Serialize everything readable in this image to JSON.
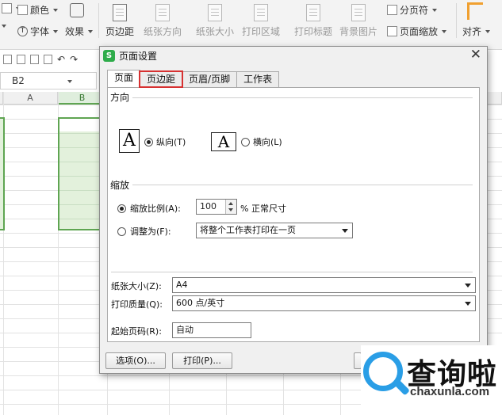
{
  "ribbon": {
    "row1_items": [
      "颜色"
    ],
    "row2_items": [
      "字体",
      "效果"
    ],
    "buttons": [
      "页边距",
      "纸张方向",
      "纸张大小",
      "打印区域",
      "打印标题",
      "背景图片"
    ],
    "right_top": "分页符",
    "right_bottom": "页面缩放",
    "far_right": "对齐"
  },
  "namebox": {
    "value": "B2"
  },
  "sheet": {
    "columns": [
      "A",
      "B"
    ]
  },
  "dialog": {
    "title": "页面设置",
    "tabs": [
      "页面",
      "页边距",
      "页眉/页脚",
      "工作表"
    ],
    "selected_tab": "页面",
    "highlighted_tab": "页边距",
    "highlight_color": "#d73131",
    "orientation": {
      "label": "方向",
      "portrait_label": "纵向(T)",
      "landscape_label": "横向(L)",
      "portrait_icon_text": "A",
      "landscape_icon_text": "A",
      "selected": "portrait"
    },
    "scaling": {
      "label": "缩放",
      "scale_option": "缩放比例(A):",
      "scale_value": "100",
      "scale_unit": "% 正常尺寸",
      "fit_option": "调整为(F):",
      "fit_value": "将整个工作表打印在一页",
      "selected": "scale"
    },
    "paper_size": {
      "label": "纸张大小(Z):",
      "value": "A4"
    },
    "print_quality": {
      "label": "打印质量(Q):",
      "value": "600 点/英寸"
    },
    "first_page": {
      "label": "起始页码(R):",
      "value": "自动"
    },
    "buttons": {
      "options": "选项(O)...",
      "print": "打印(P)..."
    }
  },
  "watermark": {
    "text": "查询啦",
    "url": "chaxunla.com",
    "color": "#2a9ee6"
  }
}
